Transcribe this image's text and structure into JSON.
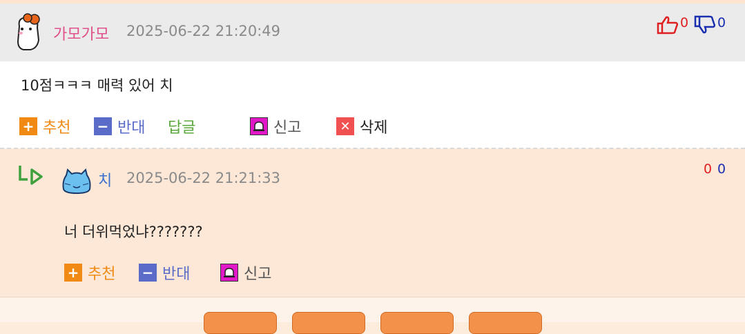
{
  "comment": {
    "nickname": "가모가모",
    "timestamp": "2025-06-22 21:20:49",
    "likes": "0",
    "dislikes": "0",
    "text": "10점ㅋㅋㅋ 매력 있어 치",
    "actions": {
      "recommend": "추천",
      "oppose": "반대",
      "reply": "답글",
      "report": "신고",
      "delete": "삭제"
    }
  },
  "reply": {
    "nickname": "치",
    "timestamp": "2025-06-22 21:21:33",
    "likes": "0",
    "dislikes": "0",
    "text": "너 더위먹었냐???????",
    "actions": {
      "recommend": "추천",
      "oppose": "반대",
      "report": "신고"
    }
  },
  "colors": {
    "like": "#e02020",
    "dislike": "#1a2fb0",
    "comment_nickname": "#e0508a",
    "reply_nickname": "#3a6fd0"
  },
  "icons": [
    "hamster-avatar",
    "thumbs-up-icon",
    "thumbs-down-icon",
    "reply-arrow-icon",
    "blue-cat-avatar",
    "plus-icon",
    "minus-icon",
    "r-icon",
    "siren-icon",
    "x-icon"
  ]
}
